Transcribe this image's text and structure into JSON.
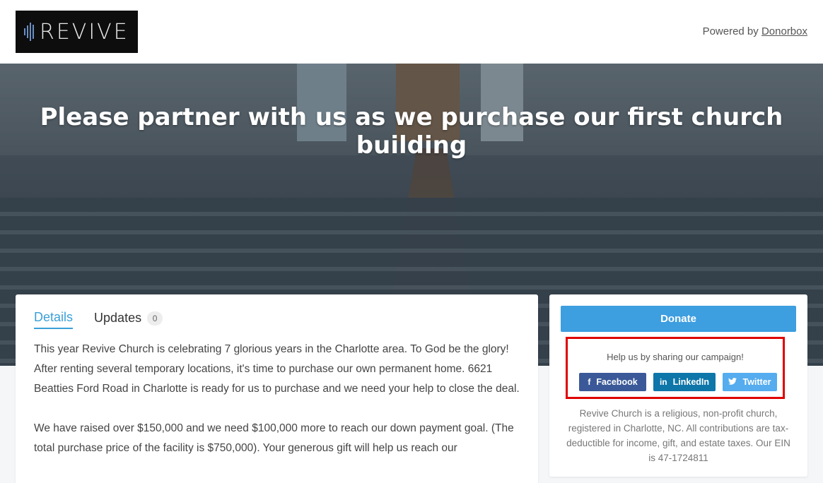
{
  "header": {
    "logo_text": "REVIVE",
    "powered_prefix": "Powered by ",
    "powered_link": "Donorbox"
  },
  "hero": {
    "title": "Please partner with us as we purchase our first church building"
  },
  "tabs": [
    {
      "label": "Details",
      "active": true
    },
    {
      "label": "Updates",
      "count": "0",
      "active": false
    }
  ],
  "content": {
    "paragraphs": [
      "This year Revive Church is celebrating 7 glorious years in the Charlotte area. To God be the glory! After renting several temporary locations, it's time to purchase our own permanent home. 6621 Beatties Ford Road in Charlotte is ready for us to purchase and we need your help to close the deal.",
      "We have raised over $150,000 and we need $100,000 more to reach our down payment goal. (The total purchase price of the facility is $750,000). Your generous gift will help us reach our"
    ]
  },
  "sidebar": {
    "donate_label": "Donate",
    "share_prompt": "Help us by sharing our campaign!",
    "share_buttons": [
      {
        "label": "Facebook",
        "icon": "facebook-icon",
        "color": "#3b5998"
      },
      {
        "label": "LinkedIn",
        "icon": "linkedin-icon",
        "color": "#0e76a8"
      },
      {
        "label": "Twitter",
        "icon": "twitter-icon",
        "color": "#55acee"
      }
    ],
    "disclaimer": "Revive Church is a religious, non-profit church, registered in Charlotte, NC. All contributions are tax-deductible for income, gift, and estate taxes. Our EIN is 47-1724811"
  },
  "colors": {
    "accent": "#3d9ee0",
    "highlight_border": "#e00000"
  }
}
